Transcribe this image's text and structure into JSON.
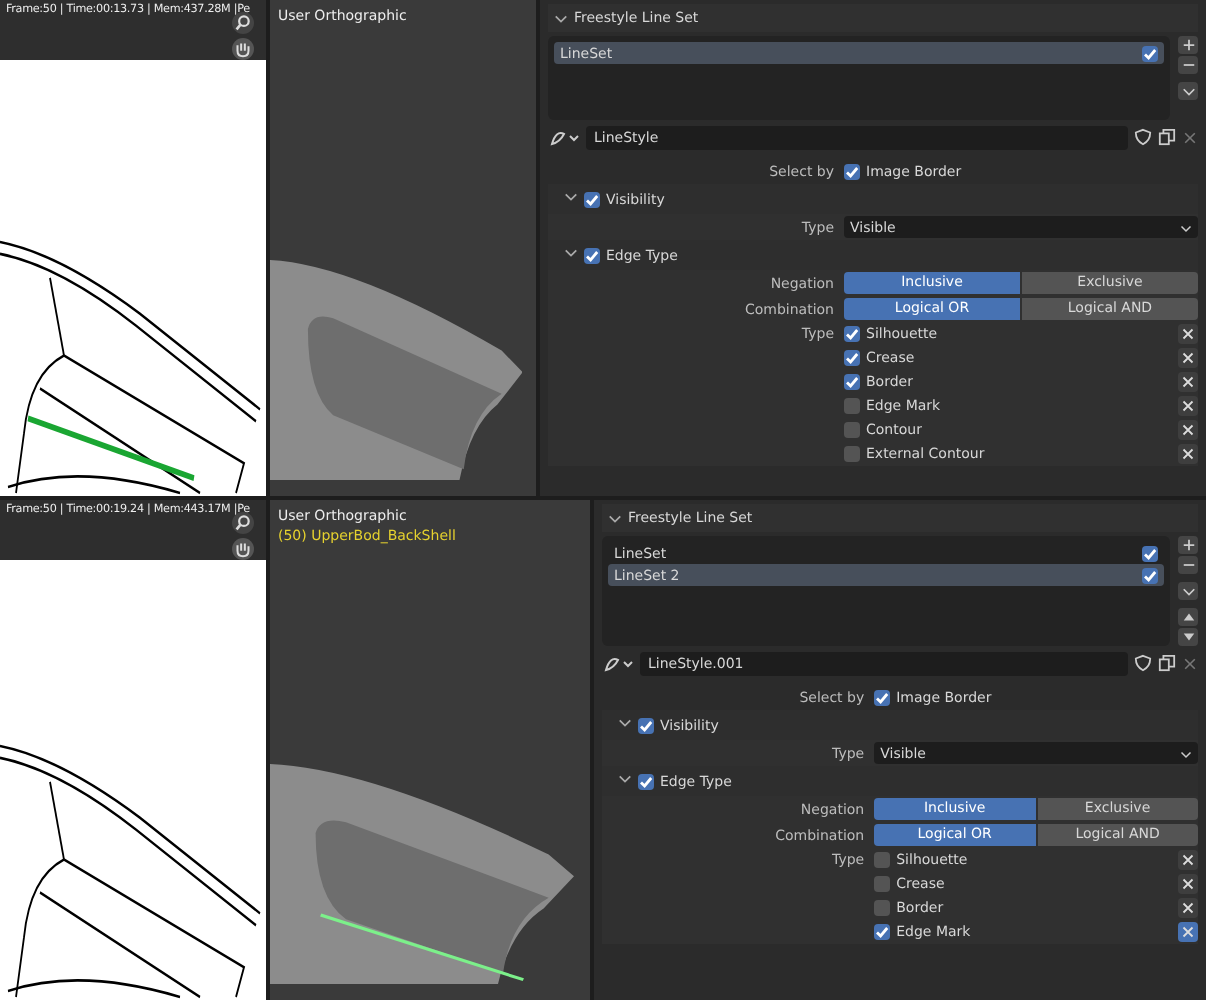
{
  "screens": [
    {
      "render": {
        "status": "Frame:50 | Time:00:13.73 | Mem:437.28M |Pe"
      },
      "viewport": {
        "title": "User Orthographic"
      },
      "properties": {
        "title": "Freestyle Line Set",
        "linesets": [
          {
            "name": "LineSet",
            "checked": true,
            "selected": true
          }
        ],
        "linestyle": "LineStyle",
        "select_by": {
          "label": "Select by",
          "option": "Image Border",
          "checked": true
        },
        "visibility": {
          "label": "Visibility",
          "checked": true,
          "expanded": true,
          "type_label": "Type",
          "type_value": "Visible"
        },
        "edge_type": {
          "label": "Edge Type",
          "checked": true,
          "expanded": true,
          "negation": {
            "label": "Negation",
            "options": [
              {
                "label": "Inclusive",
                "selected": true
              },
              {
                "label": "Exclusive",
                "selected": false
              }
            ]
          },
          "combination": {
            "label": "Combination",
            "options": [
              {
                "label": "Logical OR",
                "selected": true
              },
              {
                "label": "Logical AND",
                "selected": false
              }
            ]
          },
          "type_label": "Type",
          "types": [
            {
              "label": "Silhouette",
              "checked": true,
              "exclude": false
            },
            {
              "label": "Crease",
              "checked": true,
              "exclude": false
            },
            {
              "label": "Border",
              "checked": true,
              "exclude": false
            },
            {
              "label": "Edge Mark",
              "checked": false,
              "exclude": false
            },
            {
              "label": "Contour",
              "checked": false,
              "exclude": false
            },
            {
              "label": "External Contour",
              "checked": false,
              "exclude": false
            }
          ]
        }
      }
    },
    {
      "render": {
        "status": "Frame:50 | Time:00:19.24 | Mem:443.17M |Pe"
      },
      "viewport": {
        "title": "User Orthographic",
        "object": "(50) UpperBod_BackShell"
      },
      "properties": {
        "title": "Freestyle Line Set",
        "linesets": [
          {
            "name": "LineSet",
            "checked": true,
            "selected": false
          },
          {
            "name": "LineSet 2",
            "checked": true,
            "selected": true
          }
        ],
        "linestyle": "LineStyle.001",
        "select_by": {
          "label": "Select by",
          "option": "Image Border",
          "checked": true
        },
        "visibility": {
          "label": "Visibility",
          "checked": true,
          "expanded": true,
          "type_label": "Type",
          "type_value": "Visible"
        },
        "edge_type": {
          "label": "Edge Type",
          "checked": true,
          "expanded": true,
          "negation": {
            "label": "Negation",
            "options": [
              {
                "label": "Inclusive",
                "selected": true
              },
              {
                "label": "Exclusive",
                "selected": false
              }
            ]
          },
          "combination": {
            "label": "Combination",
            "options": [
              {
                "label": "Logical OR",
                "selected": true
              },
              {
                "label": "Logical AND",
                "selected": false
              }
            ]
          },
          "type_label": "Type",
          "types": [
            {
              "label": "Silhouette",
              "checked": false,
              "exclude": false
            },
            {
              "label": "Crease",
              "checked": false,
              "exclude": false
            },
            {
              "label": "Border",
              "checked": false,
              "exclude": false
            },
            {
              "label": "Edge Mark",
              "checked": true,
              "exclude": true
            }
          ]
        }
      }
    }
  ]
}
